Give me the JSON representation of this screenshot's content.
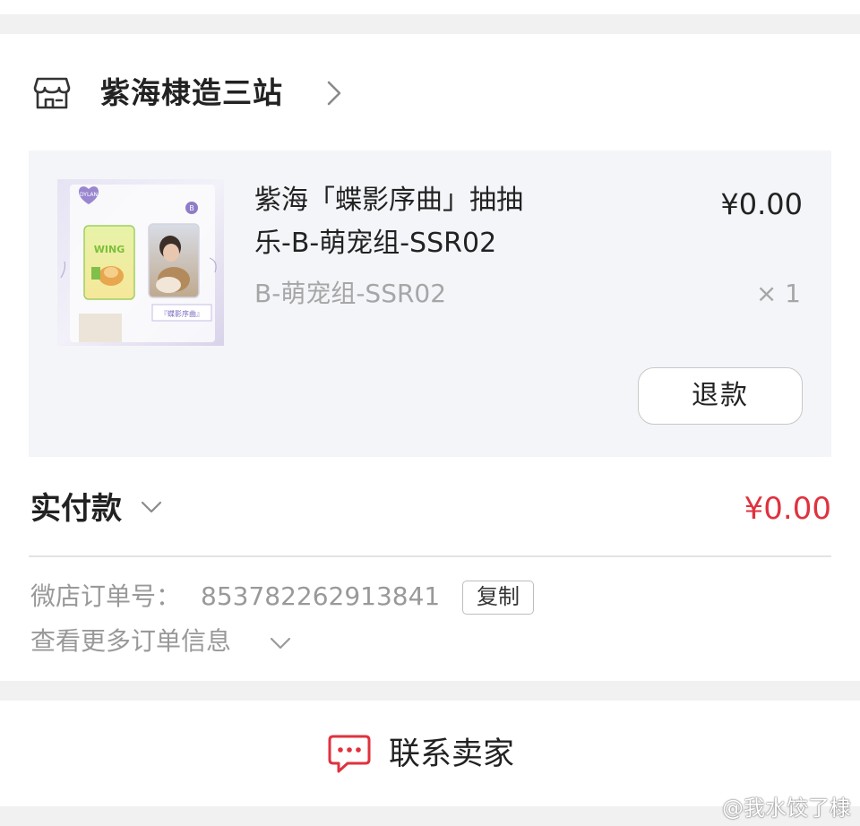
{
  "shop": {
    "name": "紫海棣造三站",
    "icon": "store-icon"
  },
  "item": {
    "title_line1": "紫海「蝶影序曲」抽抽",
    "title_line2": "乐-B-萌宠组-SSR02",
    "sku": "B-萌宠组-SSR02",
    "price": "¥0.00",
    "quantity": "× 1",
    "refund_label": "退款",
    "thumbnail": {
      "badge_text": "DYLAN",
      "letter_badge": "B",
      "card_left_text": "WING",
      "banner_text": "『蝶影序曲』"
    }
  },
  "payment": {
    "label": "实付款",
    "amount": "¥0.00"
  },
  "order": {
    "number_label": "微店订单号：",
    "number_value": "853782262913841",
    "copy_label": "复制",
    "more_label": "查看更多订单信息"
  },
  "contact": {
    "label": "联系卖家",
    "icon": "chat-bubble-icon"
  },
  "watermark": {
    "text": "@我水饺了棣"
  },
  "colors": {
    "page_background": "#f1f1f1",
    "card_background": "#ffffff",
    "item_panel": "#f4f5f8",
    "accent_red": "#e0323e",
    "muted_text": "#999999"
  }
}
